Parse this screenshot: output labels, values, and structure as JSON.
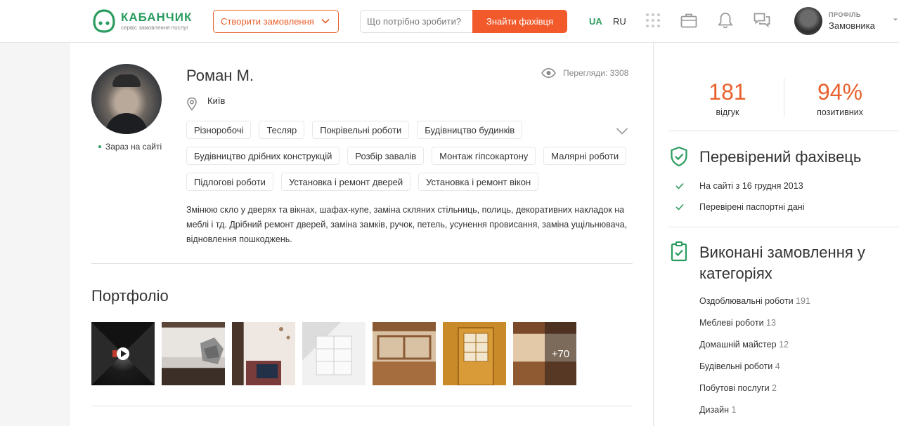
{
  "header": {
    "logo_name": "КАБАНЧИК",
    "logo_tagline": "сервіс замовлення послуг",
    "create_order_label": "Створити замовлення",
    "search_placeholder": "Що потрібно зробити?",
    "search_button_label": "Знайти фахівця",
    "lang_ua": "UA",
    "lang_ru": "RU",
    "profile_label": "ПРОФІЛЬ",
    "profile_name": "Замовника"
  },
  "profile": {
    "name": "Роман М.",
    "views_label": "Перегляди: 3308",
    "city": "Київ",
    "online_status": "Зараз на сайті",
    "tag_rows": [
      [
        "Різноробочі",
        "Тесляр",
        "Покрівельні роботи",
        "Будівництво будинків"
      ],
      [
        "Будівництво дрібних конструкцій",
        "Розбір завалів",
        "Монтаж гіпсокартону",
        "Малярні роботи"
      ],
      [
        "Підлогові роботи",
        "Установка і ремонт дверей",
        "Установка і ремонт вікон"
      ]
    ],
    "about": "Змінюю скло у дверях та вікнах, шафах-купе, заміна скляних стільниць, полиць, декоративних накладок на меблі і тд. Дрібний ремонт дверей, заміна замків, ручок, петель, усунення провисання, заміна ущільнювача, відновлення пошкоджень."
  },
  "portfolio": {
    "title": "Портфоліо",
    "more_label": "+70"
  },
  "sidebar": {
    "reviews_count": "181",
    "reviews_label": "відгук",
    "positive_percent": "94%",
    "positive_label": "позитивних",
    "verified_title": "Перевірений фахівець",
    "verified_items": [
      "На сайті з 16 грудня 2013",
      "Перевірені паспортні дані"
    ],
    "orders_title": "Виконані замовлення у категоріях",
    "categories": [
      {
        "name": "Оздоблювальні роботи",
        "count": "191"
      },
      {
        "name": "Меблеві роботи",
        "count": "13"
      },
      {
        "name": "Домашній майстер",
        "count": "12"
      },
      {
        "name": "Будівельні роботи",
        "count": "4"
      },
      {
        "name": "Побутові послуги",
        "count": "2"
      },
      {
        "name": "Дизайн",
        "count": "1"
      }
    ]
  },
  "colors": {
    "brand_green": "#2a9c5f",
    "accent_orange": "#f25a2b",
    "stat_orange": "#e8602c"
  }
}
